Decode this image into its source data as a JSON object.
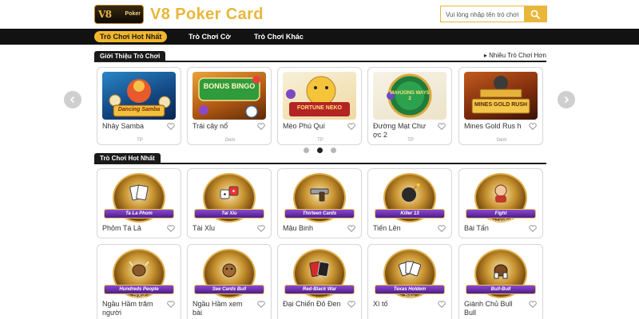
{
  "header": {
    "logo_text": "V8",
    "logo_sub": "Poker",
    "site_title": "V8 Poker Card",
    "search_placeholder": "Vui lòng nhập tên trò chơi"
  },
  "nav": {
    "items": [
      {
        "label": "Trò Chơi Hot Nhất",
        "active": true
      },
      {
        "label": "Trò Chơi Cờ"
      },
      {
        "label": "Trò Chơi Khác"
      }
    ]
  },
  "intro": {
    "title": "Giới Thiệu Trò Chơi",
    "more_label": "▸ Nhiều Trò Chơi Hơn",
    "cards": [
      {
        "title": "Nhảy Samba",
        "sub": "TP",
        "art": "Dancing Samba"
      },
      {
        "title": "Trái cây nổ",
        "sub": "Gem",
        "art": "BONUS BINGO"
      },
      {
        "title": "Mèo Phú Quí",
        "sub": "TP",
        "art": "FORTUNE NEKO"
      },
      {
        "title": "Đường Mạt Chư ợc 2",
        "sub": "TP",
        "art": "MAHJONG WAYS 2"
      },
      {
        "title": "Mines Gold Rus h",
        "sub": "Gem",
        "art": "MINES GOLD RUSH"
      }
    ],
    "pager": {
      "count": 3,
      "active": 1
    }
  },
  "hot": {
    "title": "Trò Chơi Hot Nhất",
    "cards": [
      {
        "title": "Phỏm Tá Lả",
        "badge": "Ta La Phom",
        "badge_sub": ""
      },
      {
        "title": "Tài Xỉu",
        "badge": "Tai Xiu",
        "badge_sub": ""
      },
      {
        "title": "Mậu Binh",
        "badge": "Thirteen Cards",
        "badge_sub": ""
      },
      {
        "title": "Tiến Lên",
        "badge": "Killer 13",
        "badge_sub": ""
      },
      {
        "title": "Bài Tấn",
        "badge": "Fight",
        "badge_sub": "the Landlord"
      },
      {
        "title": "Ngầu Hầm trăm người",
        "badge": "Hundreds People",
        "badge_sub": "Of Bull"
      },
      {
        "title": "Ngầu Hầm xem bài",
        "badge": "See Cards Bull",
        "badge_sub": ""
      },
      {
        "title": "Đại Chiến Đỏ Đen",
        "badge": "Red-Black War",
        "badge_sub": ""
      },
      {
        "title": "Xì tố",
        "badge": "Texas Holdem",
        "badge_sub": "Poker"
      },
      {
        "title": "Giành Chủ Bull Bull",
        "badge": "Bull-Bull",
        "badge_sub": ""
      }
    ]
  },
  "colors": {
    "accent": "#e8b73a",
    "nav_bg": "#121212",
    "dark": "#1a1a1a"
  }
}
